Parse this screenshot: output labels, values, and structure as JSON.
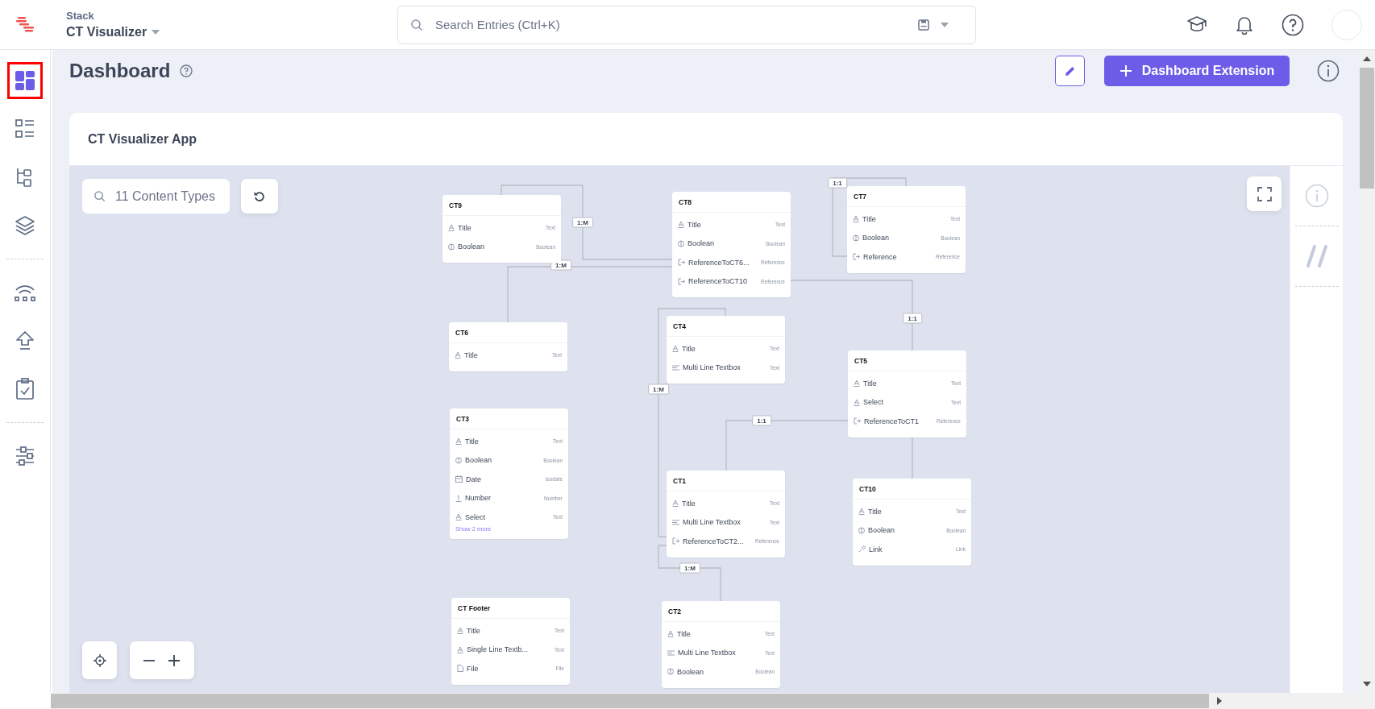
{
  "header": {
    "stack_label": "Stack",
    "stack_name": "CT Visualizer",
    "search": {
      "placeholder": "Search Entries (Ctrl+K)"
    }
  },
  "sidebar": {
    "items": [
      {
        "kind": "dashboard",
        "selected": true
      },
      {
        "kind": "list",
        "selected": false
      },
      {
        "kind": "tree",
        "selected": false
      },
      {
        "kind": "layers",
        "selected": false
      },
      {
        "kind": "divider"
      },
      {
        "kind": "signal",
        "selected": false
      },
      {
        "kind": "upload",
        "selected": false
      },
      {
        "kind": "clipboard",
        "selected": false
      },
      {
        "kind": "divider"
      },
      {
        "kind": "sliders",
        "selected": false
      }
    ]
  },
  "page": {
    "title": "Dashboard",
    "extension_button": "Dashboard Extension"
  },
  "card": {
    "title": "CT Visualizer App",
    "search": {
      "placeholder": "11 Content Types"
    },
    "content_types": [
      {
        "name": "CT9",
        "fields": [
          {
            "name": "Title",
            "type": "Text",
            "kind": "text"
          },
          {
            "name": "Boolean",
            "type": "Boolean",
            "kind": "boolean"
          }
        ]
      },
      {
        "name": "CT8",
        "fields": [
          {
            "name": "Title",
            "type": "Text",
            "kind": "text"
          },
          {
            "name": "Boolean",
            "type": "Boolean",
            "kind": "boolean"
          },
          {
            "name": "ReferenceToCT6...",
            "type": "Reference",
            "kind": "reference"
          },
          {
            "name": "ReferenceToCT10",
            "type": "Reference",
            "kind": "reference"
          }
        ]
      },
      {
        "name": "CT7",
        "fields": [
          {
            "name": "Title",
            "type": "Text",
            "kind": "text"
          },
          {
            "name": "Boolean",
            "type": "Boolean",
            "kind": "boolean"
          },
          {
            "name": "Reference",
            "type": "Reference",
            "kind": "reference"
          }
        ]
      },
      {
        "name": "CT6",
        "fields": [
          {
            "name": "Title",
            "type": "Text",
            "kind": "text"
          }
        ]
      },
      {
        "name": "CT4",
        "fields": [
          {
            "name": "Title",
            "type": "Text",
            "kind": "text"
          },
          {
            "name": "Multi Line Textbox",
            "type": "Text",
            "kind": "multiline"
          }
        ]
      },
      {
        "name": "CT5",
        "fields": [
          {
            "name": "Title",
            "type": "Text",
            "kind": "text"
          },
          {
            "name": "Select",
            "type": "Text",
            "kind": "text"
          },
          {
            "name": "ReferenceToCT1",
            "type": "Reference",
            "kind": "reference"
          }
        ]
      },
      {
        "name": "CT3",
        "fields": [
          {
            "name": "Title",
            "type": "Text",
            "kind": "text"
          },
          {
            "name": "Boolean",
            "type": "Boolean",
            "kind": "boolean"
          },
          {
            "name": "Date",
            "type": "Isodate",
            "kind": "date"
          },
          {
            "name": "Number",
            "type": "Number",
            "kind": "number"
          },
          {
            "name": "Select",
            "type": "Text",
            "kind": "text"
          }
        ],
        "more": "Show 2 more"
      },
      {
        "name": "CT1",
        "fields": [
          {
            "name": "Title",
            "type": "Text",
            "kind": "text"
          },
          {
            "name": "Multi Line Textbox",
            "type": "Text",
            "kind": "multiline"
          },
          {
            "name": "ReferenceToCT2...",
            "type": "Reference",
            "kind": "reference"
          }
        ]
      },
      {
        "name": "CT10",
        "fields": [
          {
            "name": "Title",
            "type": "Text",
            "kind": "text"
          },
          {
            "name": "Boolean",
            "type": "Boolean",
            "kind": "boolean"
          },
          {
            "name": "Link",
            "type": "Link",
            "kind": "link"
          }
        ]
      },
      {
        "name": "CT Footer",
        "fields": [
          {
            "name": "Title",
            "type": "Text",
            "kind": "text"
          },
          {
            "name": "Single Line Textb...",
            "type": "Text",
            "kind": "text"
          },
          {
            "name": "File",
            "type": "File",
            "kind": "file"
          }
        ]
      },
      {
        "name": "CT2",
        "fields": [
          {
            "name": "Title",
            "type": "Text",
            "kind": "text"
          },
          {
            "name": "Multi Line Textbox",
            "type": "Text",
            "kind": "multiline"
          },
          {
            "name": "Boolean",
            "type": "Boolean",
            "kind": "boolean"
          }
        ]
      }
    ],
    "relations": [
      {
        "label": "1:1"
      },
      {
        "label": "1:M"
      },
      {
        "label": "1:M"
      },
      {
        "label": "1:1"
      },
      {
        "label": "1:M"
      },
      {
        "label": "1:1"
      },
      {
        "label": "1:M"
      }
    ]
  }
}
